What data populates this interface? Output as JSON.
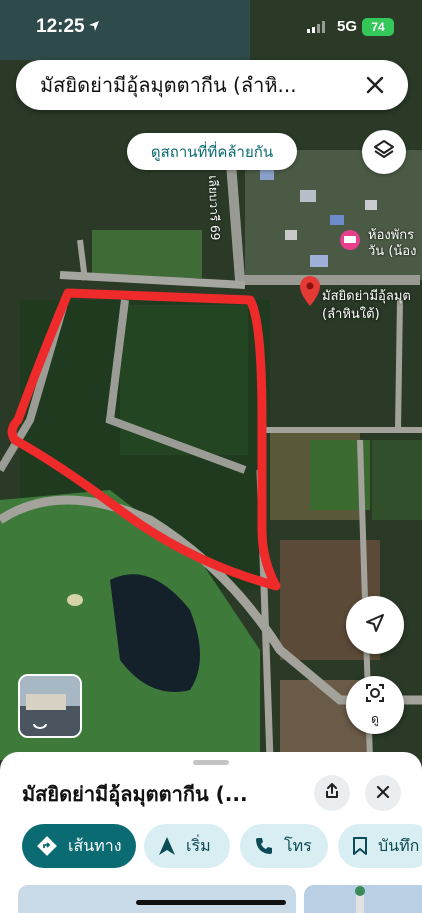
{
  "status_bar": {
    "time": "12:25",
    "network": "5G",
    "battery": "74"
  },
  "search": {
    "query": "มัสยิดย่ามีอุ้ลมุตตากีน (ลำหิ...",
    "close_icon": "close-icon"
  },
  "map": {
    "similar_places_label": "ดูสถานที่ที่คล้ายกัน",
    "road_label": "เลียบวารี 69",
    "poi_hotel_label_1": "ห้องพักร",
    "poi_hotel_label_2": "วัน (น้อง",
    "mosque_label_1": "มัสยิดย่ามีอุ้ลมุต",
    "mosque_label_2": "(ลำหินใต้)",
    "streetview_label": "ดู",
    "annotation_color": "#ee2a2a",
    "pin_color": "#e53935"
  },
  "place_sheet": {
    "title": "มัสยิดย่ามีอุ้ลมุตตากีน (..."
  },
  "actions": [
    {
      "label": "เส้นทาง",
      "icon": "directions-icon"
    },
    {
      "label": "เริ่ม",
      "icon": "navigation-arrow-icon"
    },
    {
      "label": "โทร",
      "icon": "phone-icon"
    },
    {
      "label": "บันทึก",
      "icon": "bookmark-icon"
    }
  ],
  "colors": {
    "primary": "#0b6b72",
    "chip_bg": "#d9eef2"
  }
}
